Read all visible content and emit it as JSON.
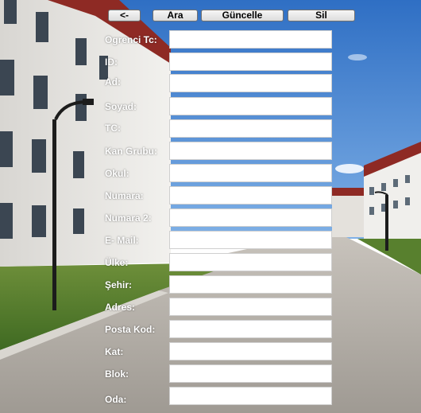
{
  "toolbar": {
    "back_label": "<-",
    "search_label": "Ara",
    "update_label": "Güncelle",
    "delete_label": "Sil"
  },
  "form": {
    "fields": [
      {
        "label": "Ogrenci Tc:",
        "value": ""
      },
      {
        "label": "ID:",
        "value": ""
      },
      {
        "label": "Ad:",
        "value": ""
      },
      {
        "label": "Soyad:",
        "value": ""
      },
      {
        "label": "TC:",
        "value": ""
      },
      {
        "label": "Kan Grubu:",
        "value": ""
      },
      {
        "label": "Okul:",
        "value": ""
      },
      {
        "label": "Numara:",
        "value": ""
      },
      {
        "label": "Numara 2:",
        "value": ""
      },
      {
        "label": "E- Mail:",
        "value": ""
      },
      {
        "label": "Ülke:",
        "value": ""
      },
      {
        "label": "Şehir:",
        "value": ""
      },
      {
        "label": "Adres:",
        "value": ""
      },
      {
        "label": "Posta Kod:",
        "value": ""
      },
      {
        "label": "Kat:",
        "value": ""
      },
      {
        "label": "Blok:",
        "value": ""
      },
      {
        "label": "Oda:",
        "value": ""
      }
    ]
  }
}
